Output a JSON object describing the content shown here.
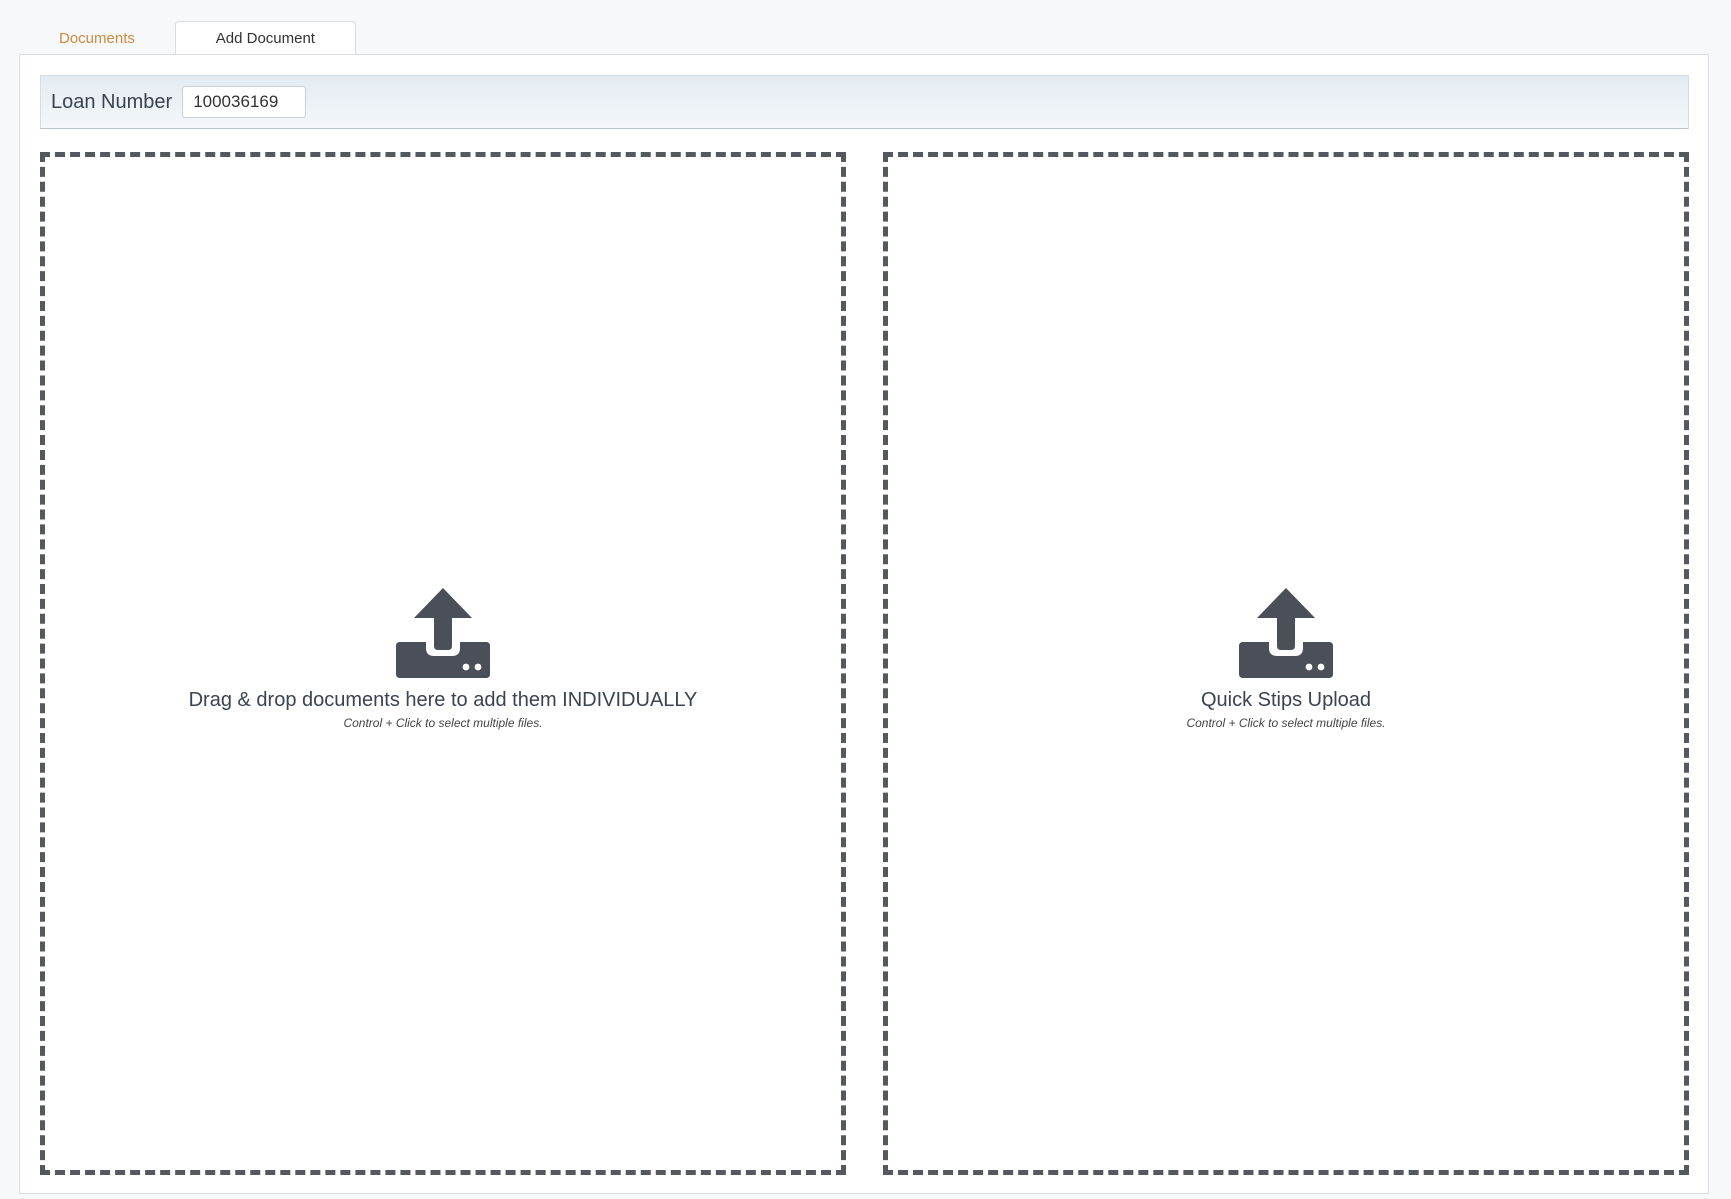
{
  "tabs": [
    {
      "label": "Documents",
      "active": false
    },
    {
      "label": "Add Document",
      "active": true
    }
  ],
  "loan": {
    "label": "Loan Number",
    "value": "100036169"
  },
  "dropzones": [
    {
      "title": "Drag & drop documents here to add them INDIVIDUALLY",
      "hint": "Control + Click to select multiple files.",
      "icon": "upload-icon"
    },
    {
      "title": "Quick Stips Upload",
      "hint": "Control + Click to select multiple files.",
      "icon": "upload-icon"
    }
  ],
  "colors": {
    "inactive_tab": "#d08a3e",
    "icon": "#4a4f58",
    "dashed_border": "#55585e"
  }
}
